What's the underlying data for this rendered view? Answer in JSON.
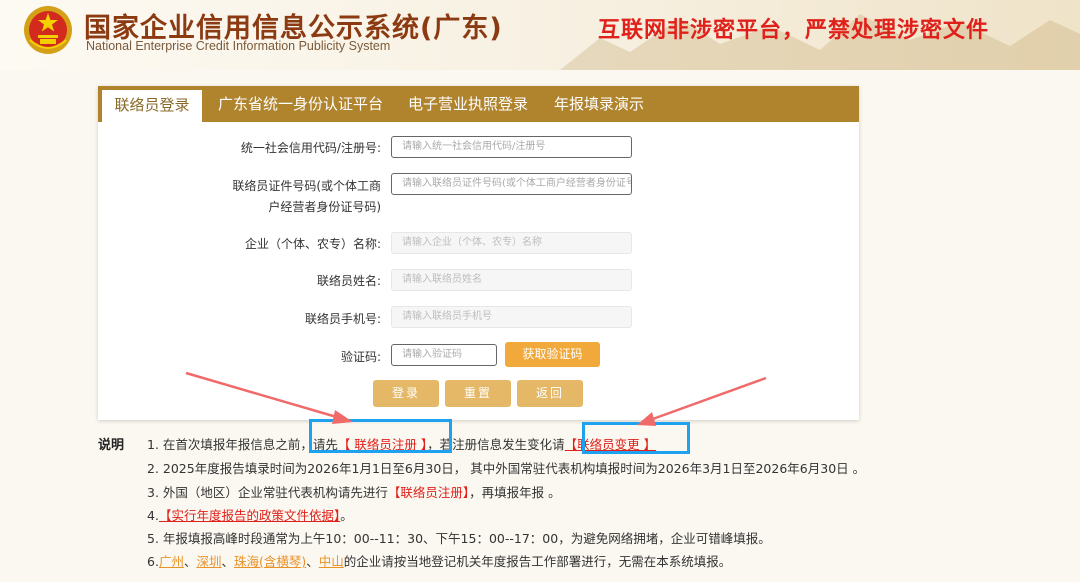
{
  "header": {
    "title": "国家企业信用信息公示系统(广东)",
    "subtitle": "National Enterprise Credit Information Publicity System",
    "warning": "互联网非涉密平台，严禁处理涉密文件"
  },
  "tabs": [
    {
      "label": "联络员登录",
      "active": true
    },
    {
      "label": "广东省统一身份认证平台",
      "active": false
    },
    {
      "label": "电子营业执照登录",
      "active": false
    },
    {
      "label": "年报填录演示",
      "active": false
    }
  ],
  "form": {
    "credit_code_label": "统一社会信用代码/注册号:",
    "credit_code_placeholder": "请输入统一社会信用代码/注册号",
    "id_label_line1": "联络员证件号码(或个体工商",
    "id_label_line2": "户经营者身份证号码)",
    "id_placeholder": "请输入联络员证件号码(或个体工商户经营者身份证号码)",
    "company_label": "企业（个体、农专）名称:",
    "company_placeholder": "请输入企业（个体、农专）名称",
    "name_label": "联络员姓名:",
    "name_placeholder": "请输入联络员姓名",
    "phone_label": "联络员手机号:",
    "phone_placeholder": "请输入联络员手机号",
    "captcha_label": "验证码:",
    "captcha_placeholder": "请输入验证码",
    "get_code_button": "获取验证码",
    "login_button": "登录",
    "reset_button": "重置",
    "back_button": "返回"
  },
  "notes": {
    "title": "说明",
    "n1_prefix": "1. 在首次填报年报信息之前，请先",
    "n1_link1": "【 联络员注册 】",
    "n1_middle": "，若注册信息发生变化请",
    "n1_link2": "【联络员变更 】",
    "n2": "2. 2025年度报告填录时间为2026年1月1日至6月30日， 其中外国常驻代表机构填报时间为2026年3月1日至2026年6月30日 。",
    "n3_prefix": "3. 外国（地区）企业常驻代表机构请先进行",
    "n3_link": "【联络员注册】",
    "n3_suffix": "，再填报年报 。",
    "n4_prefix": "4.",
    "n4_link": "【实行年度报告的政策文件依据】",
    "n4_suffix": "。",
    "n5": "5. 年报填报高峰时段通常为上午10：00--11：30、下午15：00--17：00，为避免网络拥堵，企业可错峰填报。",
    "n6_prefix": "6.",
    "n6_city1": "广州",
    "n6_city2": "深圳",
    "n6_city3": "珠海(含横琴)",
    "n6_city4": "中山",
    "n6_sep": "、",
    "n6_suffix": "的企业请按当地登记机关年度报告工作部署进行，无需在本系统填报。"
  },
  "colors": {
    "tab_bar": "#b0832d",
    "warning_red": "#e0201a",
    "highlight_blue": "#1ea2f0",
    "button_gold": "#e4b866",
    "code_button": "#f2a93b"
  }
}
